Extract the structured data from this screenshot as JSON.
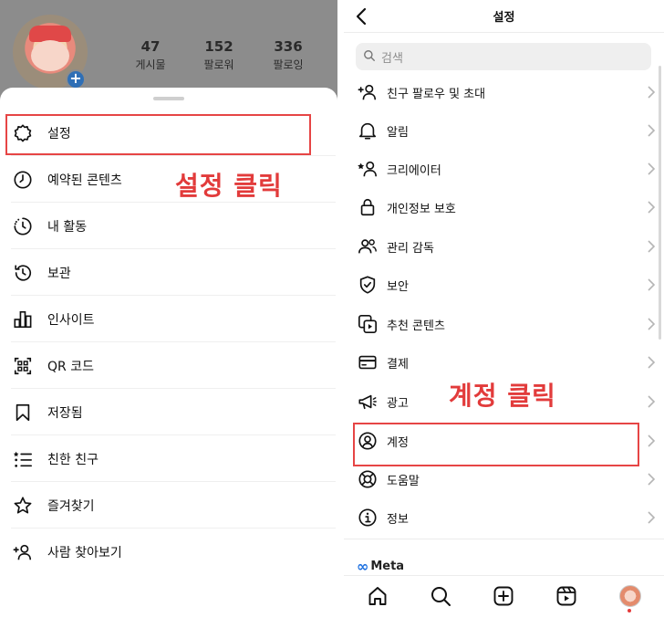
{
  "profile": {
    "stats": [
      {
        "num": "47",
        "label": "게시물"
      },
      {
        "num": "152",
        "label": "팔로워"
      },
      {
        "num": "336",
        "label": "팔로잉"
      }
    ]
  },
  "left_menu": [
    {
      "label": "설정",
      "icon": "settings-gear-icon"
    },
    {
      "label": "예약된 콘텐츠",
      "icon": "clock-icon"
    },
    {
      "label": "내 활동",
      "icon": "activity-icon"
    },
    {
      "label": "보관",
      "icon": "archive-history-icon"
    },
    {
      "label": "인사이트",
      "icon": "bar-chart-icon"
    },
    {
      "label": "QR 코드",
      "icon": "qr-code-icon"
    },
    {
      "label": "저장됨",
      "icon": "bookmark-icon"
    },
    {
      "label": "친한 친구",
      "icon": "close-friends-list-icon"
    },
    {
      "label": "즐겨찾기",
      "icon": "star-icon"
    },
    {
      "label": "사람 찾아보기",
      "icon": "add-person-icon"
    }
  ],
  "annotations": {
    "left_label": "설정 클릭",
    "right_label": "계정 클릭",
    "color": "#e23b3b"
  },
  "right": {
    "title": "설정",
    "search_placeholder": "검색",
    "items": [
      {
        "label": "친구 팔로우 및 초대",
        "icon": "add-person-icon"
      },
      {
        "label": "알림",
        "icon": "bell-icon"
      },
      {
        "label": "크리에이터",
        "icon": "creator-star-icon"
      },
      {
        "label": "개인정보 보호",
        "icon": "lock-icon"
      },
      {
        "label": "관리 감독",
        "icon": "supervision-icon"
      },
      {
        "label": "보안",
        "icon": "shield-icon"
      },
      {
        "label": "추천 콘텐츠",
        "icon": "suggested-content-icon"
      },
      {
        "label": "결제",
        "icon": "card-icon"
      },
      {
        "label": "광고",
        "icon": "megaphone-icon"
      },
      {
        "label": "계정",
        "icon": "account-icon"
      },
      {
        "label": "도움말",
        "icon": "lifebuoy-icon"
      },
      {
        "label": "정보",
        "icon": "info-icon"
      }
    ],
    "meta_label": "Meta"
  }
}
